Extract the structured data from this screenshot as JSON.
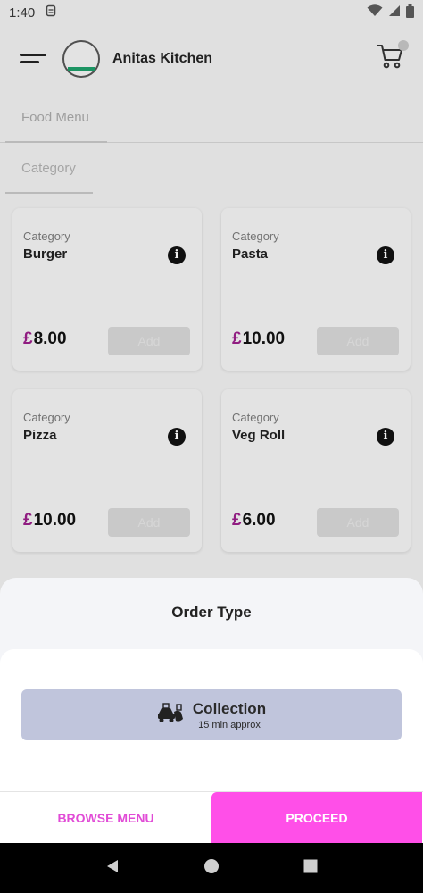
{
  "status_bar": {
    "time": "1:40"
  },
  "header": {
    "brand": "Anitas Kitchen"
  },
  "tabs": {
    "food_menu": "Food Menu",
    "category": "Category"
  },
  "products": [
    {
      "category_label": "Category",
      "name": "Burger",
      "currency": "£",
      "price": "8.00",
      "add_label": "Add"
    },
    {
      "category_label": "Category",
      "name": "Pasta",
      "currency": "£",
      "price": "10.00",
      "add_label": "Add"
    },
    {
      "category_label": "Category",
      "name": "Pizza",
      "currency": "£",
      "price": "10.00",
      "add_label": "Add"
    },
    {
      "category_label": "Category",
      "name": "Veg Roll",
      "currency": "£",
      "price": "6.00",
      "add_label": "Add"
    }
  ],
  "sheet": {
    "title": "Order Type",
    "option": {
      "title": "Collection",
      "subtitle": "15 min approx"
    },
    "browse_label": "BROWSE MENU",
    "proceed_label": "PROCEED"
  },
  "colors": {
    "accent": "#ff4fe8",
    "price_currency": "#9a1f8a",
    "option_bg": "#c0c5dc"
  }
}
